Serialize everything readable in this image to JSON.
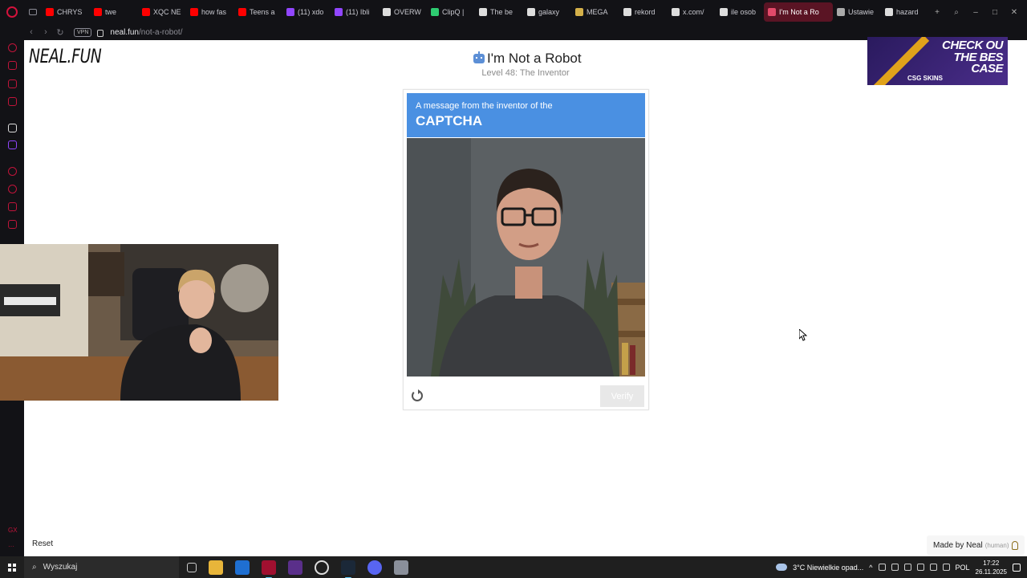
{
  "browser": {
    "tabs": [
      {
        "label": "CHRYS",
        "color": "#ff0000"
      },
      {
        "label": "twe",
        "color": "#ff0000"
      },
      {
        "label": "XQC NE",
        "color": "#ff0000"
      },
      {
        "label": "how fas",
        "color": "#ff0000"
      },
      {
        "label": "Teens a",
        "color": "#ff0000"
      },
      {
        "label": "(11) xdo",
        "color": "#9146ff"
      },
      {
        "label": "(11) Ibli",
        "color": "#9146ff"
      },
      {
        "label": "OVERW",
        "color": "#dddddd"
      },
      {
        "label": "ClipQ |",
        "color": "#2ecc71"
      },
      {
        "label": "The be",
        "color": "#dddddd"
      },
      {
        "label": "galaxy",
        "color": "#dddddd"
      },
      {
        "label": "MEGA",
        "color": "#d4b04a"
      },
      {
        "label": "rekord",
        "color": "#dddddd"
      },
      {
        "label": "x.com/",
        "color": "#dddddd"
      },
      {
        "label": "ile osob",
        "color": "#dddddd"
      },
      {
        "label": "I'm Not a Ro",
        "color": "#e24a6a",
        "active": true
      },
      {
        "label": "Ustawie",
        "color": "#aaaaaa"
      },
      {
        "label": "hazard",
        "color": "#dddddd"
      }
    ],
    "vpn_label": "VPN",
    "url_host": "neal.fun",
    "url_path": "/not-a-robot/"
  },
  "page": {
    "logo": "NEAL.FUN",
    "title": "I'm Not a Robot",
    "level": "Level 48: The Inventor",
    "captcha": {
      "header_small": "A message from the inventor of the",
      "header_big": "CAPTCHA",
      "verify_label": "Verify"
    },
    "reset_label": "Reset",
    "made_by": "Made by Neal",
    "made_by_tag": "(human)"
  },
  "ad": {
    "line1": "CHECK OU",
    "line2": "THE BES",
    "line3": "CASE",
    "brand": "CSG SKINS"
  },
  "taskbar": {
    "search_label": "Wyszukaj",
    "weather": "3°C  Niewielkie opad...",
    "language": "POL",
    "time": "17:22",
    "date": "26.11.2025"
  }
}
